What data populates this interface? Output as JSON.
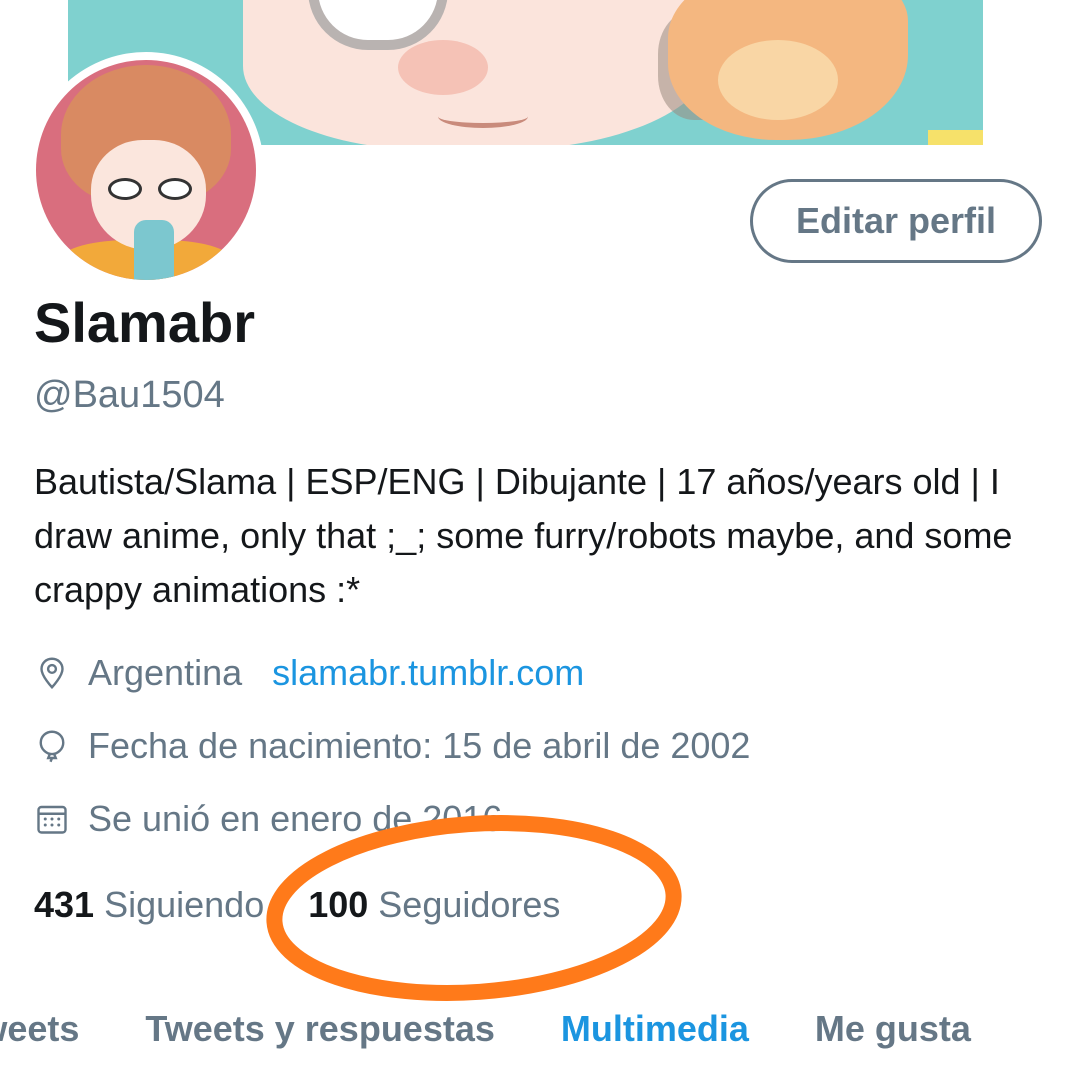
{
  "profile": {
    "name": "Slamabr",
    "handle": "@Bau1504",
    "bio": "Bautista/Slama | ESP/ENG | Dibujante | 17 años/years old | I draw anime, only that ;_; some furry/robots maybe, and some crappy animations :*",
    "edit_button": "Editar perfil",
    "location": "Argentina",
    "website": "slamabr.tumblr.com",
    "birth_date": "Fecha de nacimiento: 15 de abril de 2002",
    "joined": "Se unió en enero de 2016"
  },
  "stats": {
    "following_count": "431",
    "following_label": "Siguiendo",
    "followers_count": "100",
    "followers_label": "Seguidores"
  },
  "tabs": [
    "Tweets",
    "Tweets y respuestas",
    "Multimedia",
    "Me gusta"
  ],
  "active_tab": "Multimedia",
  "icons": {
    "location": "location-pin-icon",
    "birth": "balloon-icon",
    "joined": "calendar-icon"
  },
  "colors": {
    "accent": "#1b95e0",
    "secondary_text": "#657786",
    "annotation": "#ff7a1a"
  }
}
